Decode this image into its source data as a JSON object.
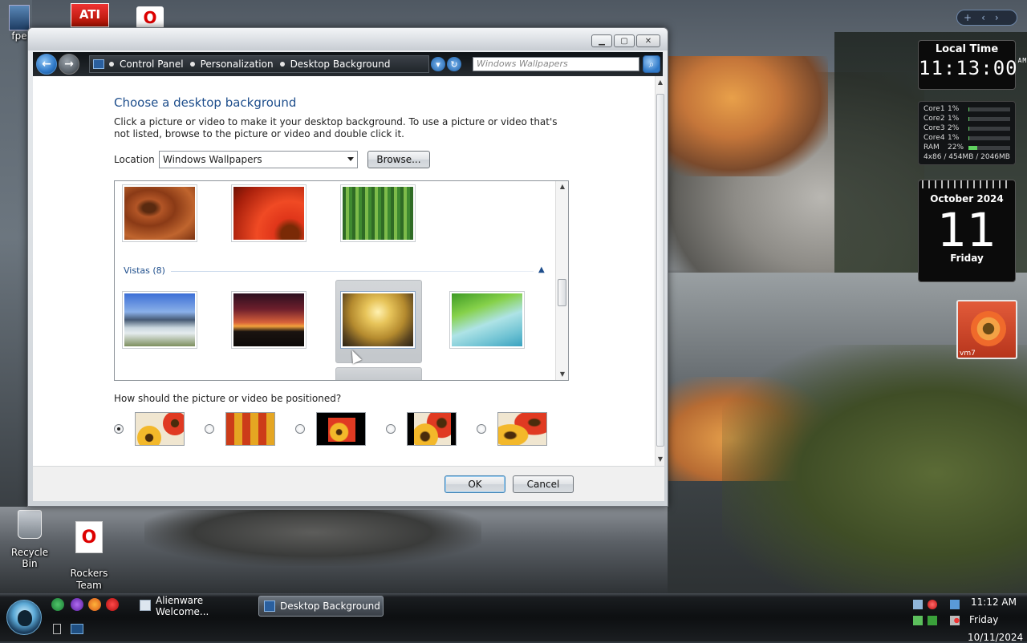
{
  "desktop": {
    "icons": [
      {
        "label": "fpe"
      },
      {
        "label": "Recycle Bin"
      },
      {
        "label": "Rockers\nTeam"
      }
    ]
  },
  "gadgets": {
    "clock": {
      "label": "Local Time",
      "time": "11:13:00",
      "ampm": "AM"
    },
    "cpu": {
      "rows": [
        {
          "name": "Core1",
          "value": "1%",
          "fraction": 0.01
        },
        {
          "name": "Core2",
          "value": "1%",
          "fraction": 0.01
        },
        {
          "name": "Core3",
          "value": "2%",
          "fraction": 0.02
        },
        {
          "name": "Core4",
          "value": "1%",
          "fraction": 0.01
        },
        {
          "name": "RAM",
          "value": "22%",
          "fraction": 0.22
        }
      ],
      "footer": "4x86 / 454MB / 2046MB"
    },
    "calendar": {
      "month": "October 2024",
      "day": "11",
      "weekday": "Friday"
    },
    "slideshow": {
      "label": "vm7"
    }
  },
  "window": {
    "breadcrumb": [
      "Control Panel",
      "Personalization",
      "Desktop Background"
    ],
    "search_placeholder": "Windows Wallpapers",
    "title": "Choose a desktop background",
    "description": "Click a picture or video to make it your desktop background. To use a picture or video that's not listed, browse to the picture or video and double click it.",
    "location_label": "Location",
    "location_value": "Windows Wallpapers",
    "browse_label": "Browse...",
    "group": {
      "label": "Vistas (8)"
    },
    "position_question": "How should the picture or video be positioned?",
    "position_options": [
      "fill",
      "tile",
      "center",
      "fit",
      "stretch"
    ],
    "selected_position": 0,
    "ok_label": "OK",
    "cancel_label": "Cancel"
  },
  "taskbar": {
    "tasks": [
      {
        "label": "Alienware Welcome..."
      },
      {
        "label": "Desktop Background"
      }
    ],
    "clock": {
      "time": "11:12 AM",
      "day": "Friday",
      "date": "10/11/2024"
    }
  }
}
